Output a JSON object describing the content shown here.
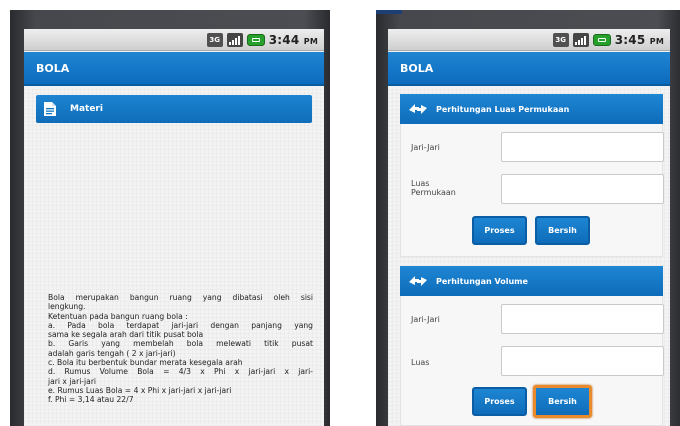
{
  "left_screen": {
    "status": {
      "network": "3G",
      "time": "3:44",
      "ampm": "PM"
    },
    "title": "BOLA",
    "menu_item": "Materi",
    "description": [
      "Bola merupakan bangun ruang yang dibatasi oleh sisi",
      "lengkung.",
      "Ketentuan pada bangun ruang bola :",
      "a. Pada bola terdapat jari-jari dengan panjang yang",
      "sama ke segala arah dari titik pusat bola",
      "b. Garis yang membelah bola melewati titik pusat",
      "adalah garis tengah ( 2 x jari-jari)",
      "c. Bola itu berbentuk bundar merata kesegala arah",
      "d. Rumus Volume Bola = 4/3 x Phi x jari-jari x jari-",
      "jari x jari-jari",
      "e. Rumus Luas Bola = 4 x Phi x jari-jari x jari-jari",
      "f. Phi = 3,14 atau 22/7"
    ]
  },
  "right_screen": {
    "status": {
      "network": "3G",
      "time": "3:45",
      "ampm": "PM"
    },
    "title": "BOLA",
    "luas_section": {
      "title": "Perhitungan Luas Permukaan",
      "label_jari": "Jari-Jari",
      "label_luas_1": "Luas",
      "label_luas_2": "Permukaan",
      "jari_value": "",
      "luas_value": "",
      "proses": "Proses",
      "bersih": "Bersih"
    },
    "volume_section": {
      "title": "Perhitungan Volume",
      "label_jari": "Jari-Jari",
      "label_luas": "Luas",
      "jari_value": "",
      "luas_value": "",
      "proses": "Proses",
      "bersih": "Bersih"
    }
  },
  "colors": {
    "primary": "#1079c6",
    "focus": "#e98a2c",
    "bezel": "#46484d"
  },
  "icons": {
    "menu_item": "document-icon",
    "section": "arrows-icon"
  }
}
